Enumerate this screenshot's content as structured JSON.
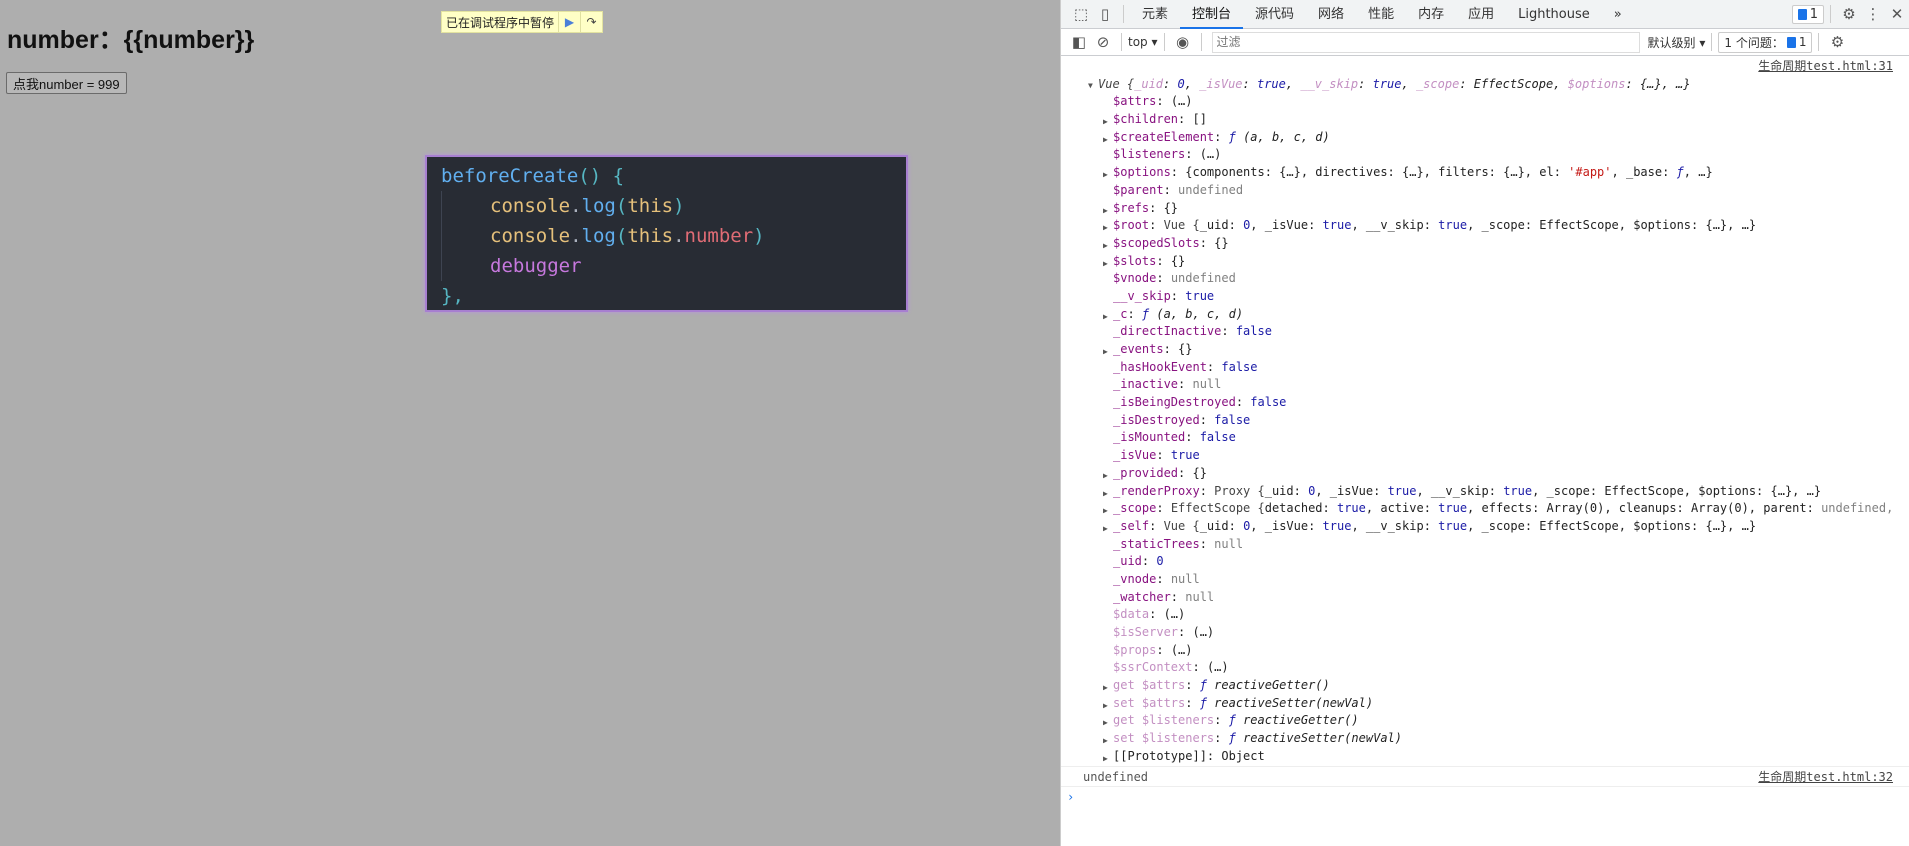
{
  "page": {
    "heading": "number：{{number}}",
    "button": "点我number = 999",
    "paused_label": "已在调试程序中暂停",
    "resume_icon": "resume-icon",
    "step_icon": "step-over-icon"
  },
  "code": {
    "l1a": "beforeCreate",
    "l1b": "() {",
    "l2a": "console",
    "l2b": ".",
    "l2c": "log",
    "l2d": "(",
    "l2e": "this",
    "l2f": ")",
    "l3a": "console",
    "l3b": ".",
    "l3c": "log",
    "l3d": "(",
    "l3e": "this",
    "l3f": ".",
    "l3g": "number",
    "l3h": ")",
    "l4": "debugger",
    "l5": "},"
  },
  "devtools": {
    "tabs": [
      "元素",
      "控制台",
      "源代码",
      "网络",
      "性能",
      "内存",
      "应用",
      "Lighthouse"
    ],
    "active_tab": "控制台",
    "more": "»",
    "issues_badge": "1",
    "context": "top",
    "filter_placeholder": "过滤",
    "level": "默认级别",
    "issues": "1 个问题：",
    "issues_count": "1",
    "log1_source": "生命周期test.html:31",
    "log2_source": "生命周期test.html:32",
    "log2_value": "undefined",
    "vue_summary": [
      [
        "Vue {",
        "it g"
      ],
      [
        "_uid",
        "it kd"
      ],
      [
        ": ",
        "it"
      ],
      [
        "0",
        "it n"
      ],
      [
        ", ",
        "it"
      ],
      [
        "_isVue",
        "it kd"
      ],
      [
        ": ",
        "it"
      ],
      [
        "true",
        "it n"
      ],
      [
        ", ",
        "it"
      ],
      [
        "__v_skip",
        "it kd"
      ],
      [
        ": ",
        "it"
      ],
      [
        "true",
        "it n"
      ],
      [
        ", ",
        "it"
      ],
      [
        "_scope",
        "it kd"
      ],
      [
        ": EffectScope, ",
        "it"
      ],
      [
        "$options",
        "it kd"
      ],
      [
        ": {…}, …}",
        "it"
      ]
    ],
    "props": [
      {
        "a": false,
        "k": "$attrs",
        "d": false,
        "v": [
          [
            " (…)",
            ""
          ]
        ]
      },
      {
        "a": true,
        "k": "$children",
        "d": false,
        "v": [
          [
            "[]",
            ""
          ]
        ]
      },
      {
        "a": true,
        "k": "$createElement",
        "d": false,
        "v": [
          [
            "ƒ ",
            "f"
          ],
          [
            "(a, b, c, d)",
            "it"
          ]
        ]
      },
      {
        "a": false,
        "k": "$listeners",
        "d": false,
        "v": [
          [
            " (…)",
            ""
          ]
        ]
      },
      {
        "a": true,
        "k": "$options",
        "d": false,
        "v": [
          [
            "{components: {…}, directives: {…}, filters: {…}, el: ",
            ""
          ],
          [
            "'#app'",
            "s"
          ],
          [
            ", _base: ",
            ""
          ],
          [
            "ƒ",
            "f"
          ],
          [
            ", …}",
            ""
          ]
        ]
      },
      {
        "a": false,
        "k": "$parent",
        "d": false,
        "v": [
          [
            "undefined",
            "nul"
          ]
        ]
      },
      {
        "a": true,
        "k": "$refs",
        "d": false,
        "v": [
          [
            "{}",
            ""
          ]
        ]
      },
      {
        "a": true,
        "k": "$root",
        "d": false,
        "v": [
          [
            "Vue {",
            "g"
          ],
          [
            "_uid: ",
            ""
          ],
          [
            "0",
            "n"
          ],
          [
            ", _isVue: ",
            ""
          ],
          [
            "true",
            "n"
          ],
          [
            ", __v_skip: ",
            ""
          ],
          [
            "true",
            "n"
          ],
          [
            ", _scope: EffectScope, $options: {…}, …}",
            ""
          ]
        ]
      },
      {
        "a": true,
        "k": "$scopedSlots",
        "d": false,
        "v": [
          [
            "{}",
            ""
          ]
        ]
      },
      {
        "a": true,
        "k": "$slots",
        "d": false,
        "v": [
          [
            "{}",
            ""
          ]
        ]
      },
      {
        "a": false,
        "k": "$vnode",
        "d": false,
        "v": [
          [
            "undefined",
            "nul"
          ]
        ]
      },
      {
        "a": false,
        "k": "__v_skip",
        "d": false,
        "v": [
          [
            "true",
            "n"
          ]
        ]
      },
      {
        "a": true,
        "k": "_c",
        "d": false,
        "v": [
          [
            "ƒ ",
            "f"
          ],
          [
            "(a, b, c, d)",
            "it"
          ]
        ]
      },
      {
        "a": false,
        "k": "_directInactive",
        "d": false,
        "v": [
          [
            "false",
            "n"
          ]
        ]
      },
      {
        "a": true,
        "k": "_events",
        "d": false,
        "v": [
          [
            "{}",
            ""
          ]
        ]
      },
      {
        "a": false,
        "k": "_hasHookEvent",
        "d": false,
        "v": [
          [
            "false",
            "n"
          ]
        ]
      },
      {
        "a": false,
        "k": "_inactive",
        "d": false,
        "v": [
          [
            "null",
            "nul"
          ]
        ]
      },
      {
        "a": false,
        "k": "_isBeingDestroyed",
        "d": false,
        "v": [
          [
            "false",
            "n"
          ]
        ]
      },
      {
        "a": false,
        "k": "_isDestroyed",
        "d": false,
        "v": [
          [
            "false",
            "n"
          ]
        ]
      },
      {
        "a": false,
        "k": "_isMounted",
        "d": false,
        "v": [
          [
            "false",
            "n"
          ]
        ]
      },
      {
        "a": false,
        "k": "_isVue",
        "d": false,
        "v": [
          [
            "true",
            "n"
          ]
        ]
      },
      {
        "a": true,
        "k": "_provided",
        "d": false,
        "v": [
          [
            "{}",
            ""
          ]
        ]
      },
      {
        "a": true,
        "k": "_renderProxy",
        "d": false,
        "v": [
          [
            "Proxy {",
            "g"
          ],
          [
            "_uid: ",
            ""
          ],
          [
            "0",
            "n"
          ],
          [
            ", _isVue: ",
            ""
          ],
          [
            "true",
            "n"
          ],
          [
            ", __v_skip: ",
            ""
          ],
          [
            "true",
            "n"
          ],
          [
            ", _scope: EffectScope, $options: {…}, …}",
            ""
          ]
        ]
      },
      {
        "a": true,
        "k": "_scope",
        "d": false,
        "v": [
          [
            "EffectScope {",
            "g"
          ],
          [
            "detached: ",
            ""
          ],
          [
            "true",
            "n"
          ],
          [
            ", active: ",
            ""
          ],
          [
            "true",
            "n"
          ],
          [
            ", effects: Array(0), cleanups: Array(0), parent: ",
            ""
          ],
          [
            "undefined,",
            "nul"
          ]
        ]
      },
      {
        "a": true,
        "k": "_self",
        "d": false,
        "v": [
          [
            "Vue {",
            "g"
          ],
          [
            "_uid: ",
            ""
          ],
          [
            "0",
            "n"
          ],
          [
            ", _isVue: ",
            ""
          ],
          [
            "true",
            "n"
          ],
          [
            ", __v_skip: ",
            ""
          ],
          [
            "true",
            "n"
          ],
          [
            ", _scope: EffectScope, $options: {…}, …}",
            ""
          ]
        ]
      },
      {
        "a": false,
        "k": "_staticTrees",
        "d": false,
        "v": [
          [
            "null",
            "nul"
          ]
        ]
      },
      {
        "a": false,
        "k": "_uid",
        "d": false,
        "v": [
          [
            "0",
            "n"
          ]
        ]
      },
      {
        "a": false,
        "k": "_vnode",
        "d": false,
        "v": [
          [
            "null",
            "nul"
          ]
        ]
      },
      {
        "a": false,
        "k": "_watcher",
        "d": false,
        "v": [
          [
            "null",
            "nul"
          ]
        ]
      },
      {
        "a": false,
        "k": "$data",
        "d": true,
        "v": [
          [
            " (…)",
            ""
          ]
        ]
      },
      {
        "a": false,
        "k": "$isServer",
        "d": true,
        "v": [
          [
            " (…)",
            ""
          ]
        ]
      },
      {
        "a": false,
        "k": "$props",
        "d": true,
        "v": [
          [
            " (…)",
            ""
          ]
        ]
      },
      {
        "a": false,
        "k": "$ssrContext",
        "d": true,
        "v": [
          [
            " (…)",
            ""
          ]
        ]
      },
      {
        "a": true,
        "k": "get $attrs",
        "d": true,
        "v": [
          [
            "ƒ ",
            "f"
          ],
          [
            "reactiveGetter()",
            "it"
          ]
        ]
      },
      {
        "a": true,
        "k": "set $attrs",
        "d": true,
        "v": [
          [
            "ƒ ",
            "f"
          ],
          [
            "reactiveSetter(newVal)",
            "it"
          ]
        ]
      },
      {
        "a": true,
        "k": "get $listeners",
        "d": true,
        "v": [
          [
            "ƒ ",
            "f"
          ],
          [
            "reactiveGetter()",
            "it"
          ]
        ]
      },
      {
        "a": true,
        "k": "set $listeners",
        "d": true,
        "v": [
          [
            "ƒ ",
            "f"
          ],
          [
            "reactiveSetter(newVal)",
            "it"
          ]
        ]
      },
      {
        "a": true,
        "k": "[[Prototype]]",
        "d": false,
        "g": true,
        "v": [
          [
            "Object",
            ""
          ]
        ]
      }
    ]
  }
}
